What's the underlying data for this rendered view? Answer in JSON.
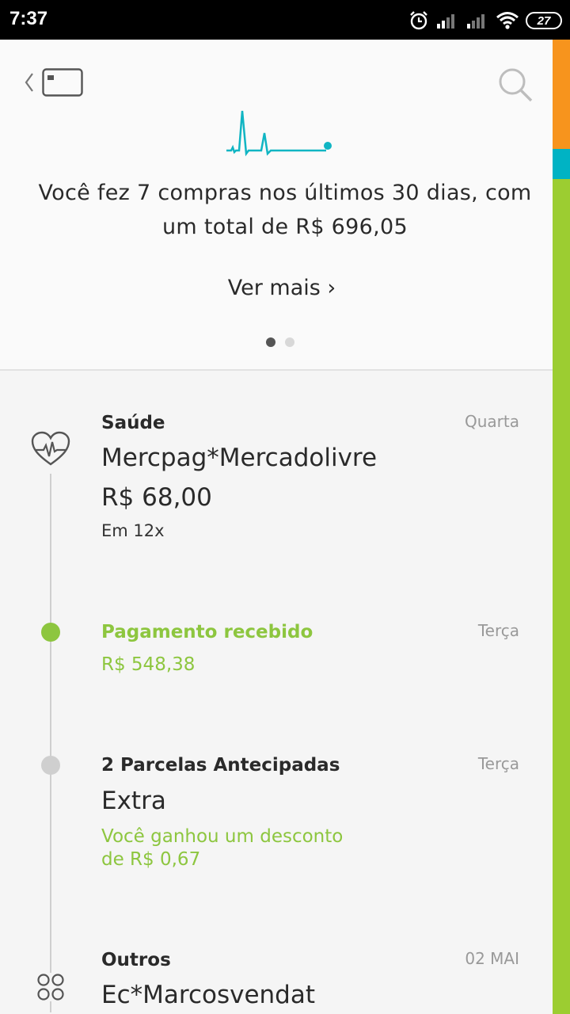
{
  "status_bar": {
    "time": "7:37",
    "battery": "27",
    "icons": [
      "alarm-icon",
      "signal-icon",
      "signal-icon",
      "wifi-icon",
      "battery-icon"
    ]
  },
  "colors": {
    "accent_teal": "#10b5c3",
    "accent_green": "#8dc63f",
    "strip_orange": "#f7941d",
    "strip_teal": "#00b3c4",
    "strip_green": "#9ccd31"
  },
  "header": {
    "summary": "Você fez 7 compras nos últimos 30 dias, com um total de R$ 696,05",
    "ver_mais": "Ver mais ›",
    "page_count": 2,
    "active_page": 1
  },
  "feed": {
    "items": [
      {
        "icon": "heart-pulse-icon",
        "category": "Saúde",
        "date": "Quarta",
        "merchant": "Mercpag*Mercadolivre",
        "amount": "R$ 68,00",
        "installments": "Em 12x"
      },
      {
        "icon": "green-dot",
        "title": "Pagamento recebido",
        "date": "Terça",
        "amount": "R$ 548,38"
      },
      {
        "icon": "gray-dot",
        "category": "2 Parcelas Antecipadas",
        "date": "Terça",
        "merchant": "Extra",
        "discount_line1": "Você ganhou um desconto",
        "discount_line2": "de R$ 0,67"
      },
      {
        "icon": "grid-circles-icon",
        "category": "Outros",
        "date": "02 MAI",
        "merchant": "Ec*Marcosvendat"
      }
    ]
  }
}
